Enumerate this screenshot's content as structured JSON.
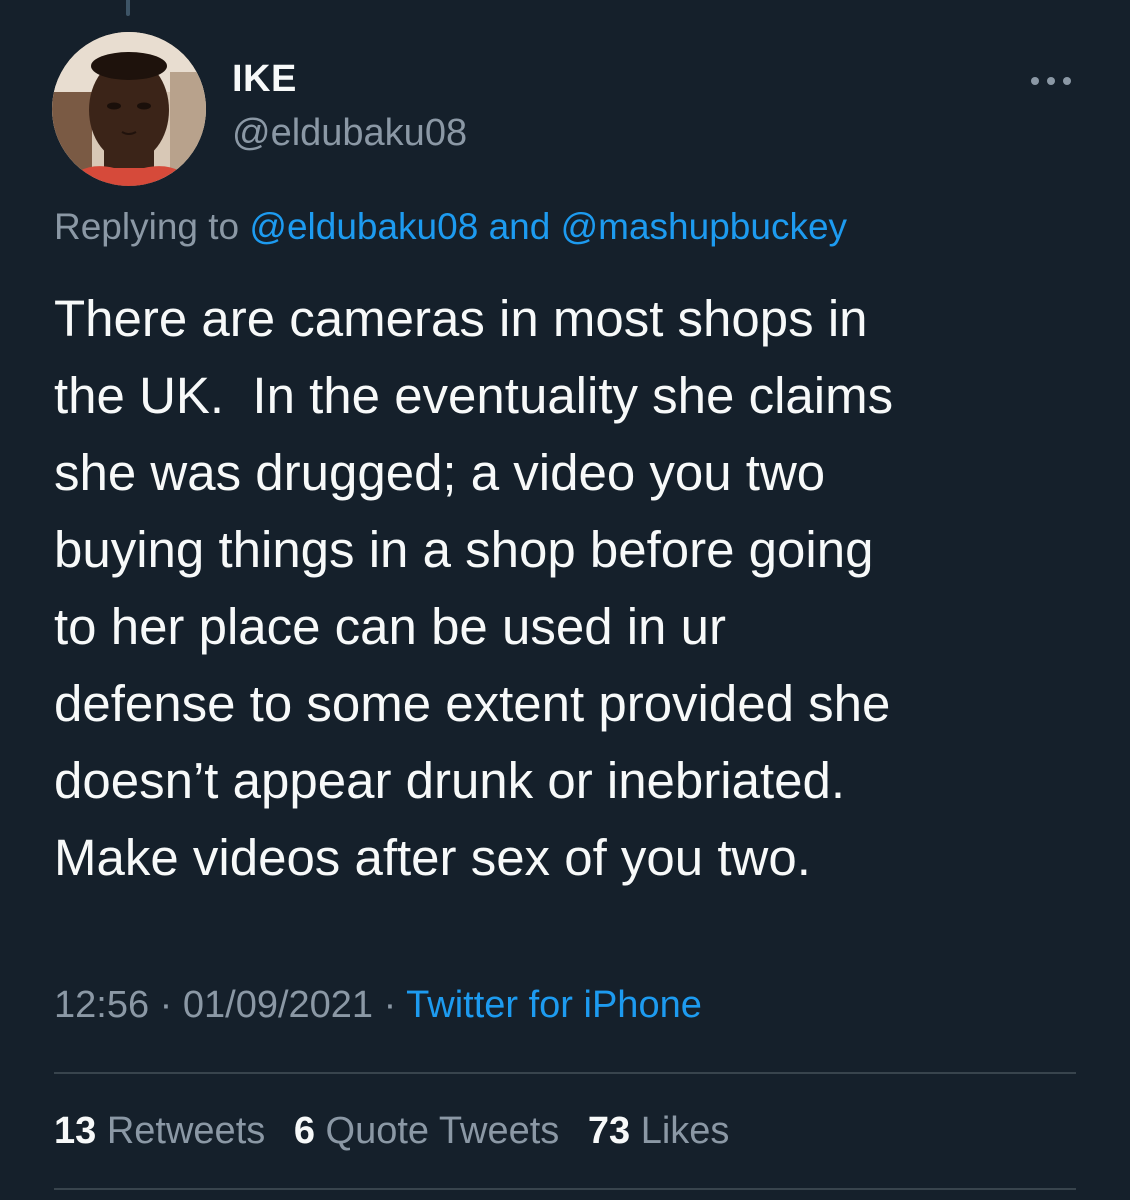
{
  "tweet": {
    "author": {
      "name": "IKE",
      "handle": "@eldubaku08"
    },
    "reply": {
      "prefix": "Replying to",
      "mention1": "@eldubaku08",
      "conjunction": "and",
      "mention2": "@mashupbuckey"
    },
    "text": "There are cameras in most shops in\nthe UK.  In the eventuality she claims\nshe was drugged; a video you two\nbuying things in a shop before going\nto her place can be used in ur\ndefense to some extent provided she\ndoesn’t appear drunk or inebriated.\nMake videos after sex of you two.",
    "time": "12:56",
    "separator": "·",
    "date": "01/09/2021",
    "source": "Twitter for iPhone",
    "stats": {
      "retweets_count": "13",
      "retweets_label": "Retweets",
      "quotes_count": "6",
      "quotes_label": "Quote Tweets",
      "likes_count": "73",
      "likes_label": "Likes"
    }
  },
  "icons": {
    "more": "more-horizontal-icon",
    "avatar": "profile-photo"
  },
  "colors": {
    "background": "#15202b",
    "text_primary": "#f7f9f9",
    "text_secondary": "#8b98a5",
    "link": "#1d9bf0",
    "divider": "#38444d"
  }
}
